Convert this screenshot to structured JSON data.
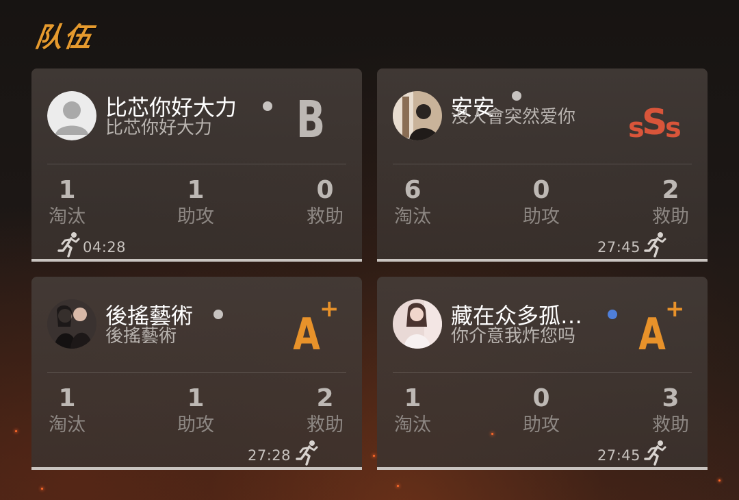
{
  "header": {
    "title": "队伍"
  },
  "cards": [
    {
      "name": "比芯你好大力",
      "subtitle": "比芯你好大力",
      "status_color": "#c7c3c0",
      "rank": "B",
      "rank_icon": "rank-b-icon",
      "avatar_icon": "default-user-avatar",
      "stats": [
        {
          "value": "1",
          "label": "淘汰"
        },
        {
          "value": "1",
          "label": "助攻"
        },
        {
          "value": "0",
          "label": "救助"
        }
      ],
      "time": "04:28"
    },
    {
      "name": "安安",
      "subtitle": "沒人會突然爱你",
      "status_color": "#c7c3c0",
      "rank": "SSS",
      "rank_icon": "rank-sss-icon",
      "avatar_icon": "photo-avatar",
      "stats": [
        {
          "value": "6",
          "label": "淘汰"
        },
        {
          "value": "0",
          "label": "助攻"
        },
        {
          "value": "2",
          "label": "救助"
        }
      ],
      "time": "27:45"
    },
    {
      "name": "後搖藝術",
      "subtitle": "後搖藝術",
      "status_color": "#c7c3c0",
      "rank": "A+",
      "rank_icon": "rank-a-plus-icon",
      "avatar_icon": "photo-avatar",
      "stats": [
        {
          "value": "1",
          "label": "淘汰"
        },
        {
          "value": "1",
          "label": "助攻"
        },
        {
          "value": "2",
          "label": "救助"
        }
      ],
      "time": "27:28"
    },
    {
      "name": "藏在众多孤…",
      "subtitle": "你介意我炸您吗",
      "status_color": "#4f7fd9",
      "rank": "A+",
      "rank_icon": "rank-a-plus-icon",
      "avatar_icon": "photo-avatar",
      "stats": [
        {
          "value": "1",
          "label": "淘汰"
        },
        {
          "value": "0",
          "label": "助攻"
        },
        {
          "value": "3",
          "label": "救助"
        }
      ],
      "time": "27:45"
    }
  ],
  "colors": {
    "title": "#e59a2e",
    "rank_b": "#bdb8b4",
    "rank_sss": "#d9553a",
    "rank_a": "#e8922a"
  }
}
